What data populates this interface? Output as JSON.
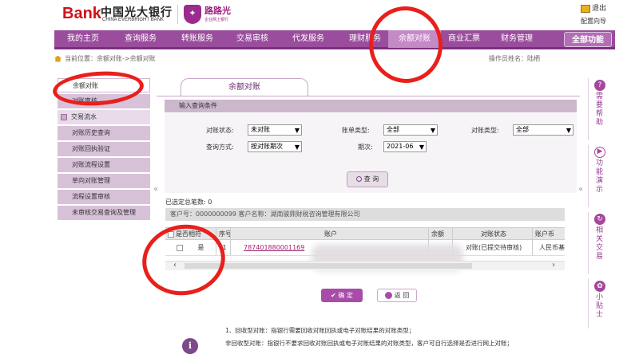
{
  "header": {
    "logo_mark": "Bank",
    "bank_name": "中国光大银行",
    "bank_name_en": "CHINA EVERBRIGHT BANK",
    "brand2_name": "路路光",
    "brand2_tagline": "企业网上银行",
    "exit_label": "退出",
    "guide_label": "配置向导"
  },
  "nav": {
    "items": [
      "我的主页",
      "查询服务",
      "转账服务",
      "交易审核",
      "代发服务",
      "理财服务",
      "余额对账",
      "商业汇票",
      "财务管理"
    ],
    "all_functions": "全部功能"
  },
  "breadcrumb": {
    "text": "当前位置：余额对账->余额对账",
    "operator": "操作员姓名：陆栖"
  },
  "sidebar": {
    "items": [
      {
        "label": "余额对账",
        "kind": "active"
      },
      {
        "label": "对账审核",
        "kind": "normal"
      },
      {
        "label": "交易流水",
        "kind": "section"
      },
      {
        "label": "对账历史查询",
        "kind": "normal"
      },
      {
        "label": "对账回执验证",
        "kind": "normal"
      },
      {
        "label": "对账流程设置",
        "kind": "normal"
      },
      {
        "label": "单向对账管理",
        "kind": "normal"
      },
      {
        "label": "流程设置审核",
        "kind": "normal"
      },
      {
        "label": "未审核交易查询及管理",
        "kind": "normal"
      }
    ]
  },
  "main": {
    "tab": "余额对账",
    "section_title": "输入查询条件",
    "form": {
      "status_label": "对账状态:",
      "status_value": "未对账",
      "bill_type_label": "账单类型:",
      "bill_type_value": "全部",
      "recon_type_label": "对账类型:",
      "recon_type_value": "全部",
      "query_mode_label": "查询方式:",
      "query_mode_value": "按对账期次",
      "period_label": "期次:",
      "period_value": "2021-06"
    },
    "query_button": "查 询",
    "selected_label": "已选定总笔数:",
    "selected_count": "0",
    "account_info": "客户号：0000000099    客户名称：湖南骏鼎财税咨询管理有限公司",
    "table": {
      "headers": [
        "是否相符",
        "序号",
        "账户",
        "余额",
        "对账状态",
        "账户币"
      ],
      "rows": [
        {
          "match": "是",
          "index": "1",
          "account": "787401880001169",
          "balance": "",
          "status": "对账(已提交待审核)",
          "currency": "人民币基"
        }
      ]
    },
    "ok_button": "确 定",
    "back_button": "返 回",
    "notes": [
      "1、回收型对账：指银行需要回收对账回执或电子对账结果的对账类型；",
      "非回收型对账：指银行不要求回收对账回执或电子对账结果的对账类型，客户可自行选择是否进行网上对账；"
    ]
  },
  "right_panel": {
    "items": [
      {
        "icon": "?",
        "label": "需要帮助"
      },
      {
        "icon": "▶",
        "label": "功能演示"
      },
      {
        "icon": "↻",
        "label": "相关交易"
      },
      {
        "icon": "✿",
        "label": "小贴士"
      }
    ]
  },
  "colors": {
    "nav_bg": "#9a4d9d",
    "nav_active": "#c48ac6",
    "annotation_red": "#e8201c",
    "brand_red": "#d0121b"
  }
}
